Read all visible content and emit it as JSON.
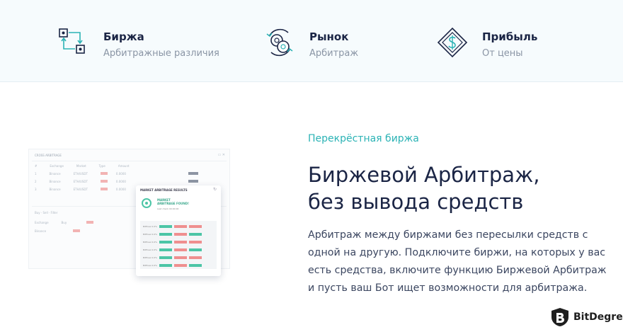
{
  "features": [
    {
      "title": "Биржа",
      "subtitle": "Арбитражные различия",
      "icon": "exchange-arrows-icon"
    },
    {
      "title": "Рынок",
      "subtitle": "Арбитраж",
      "icon": "coins-cycle-icon"
    },
    {
      "title": "Прибыль",
      "subtitle": "От цены",
      "icon": "dollar-diamond-icon"
    }
  ],
  "main": {
    "eyebrow": "Перекрёстная биржа",
    "headline_line1": "Биржевой Арбитраж,",
    "headline_line2": "без вывода средств",
    "paragraph": "Арбитраж между биржами без пересылки средств с одной на другую. Подключите биржи, на которых у вас есть средства, включите функцию Биржевой Арбитраж и пусть ваш Бот ищет возможности для арбитража."
  },
  "mock": {
    "header": "CROSS ARBITRAGE",
    "popup_title": "MARKET ARBITRAGE RESULTS",
    "popup_result_line1": "MARKET",
    "popup_result_line2": "ARBITRAGE FOUND!",
    "popup_time": "Last check 00:00:00"
  },
  "brand": {
    "name": "BitDegree",
    "accent": "#2bb3b5",
    "icon": "bitdegree-shield-icon"
  }
}
